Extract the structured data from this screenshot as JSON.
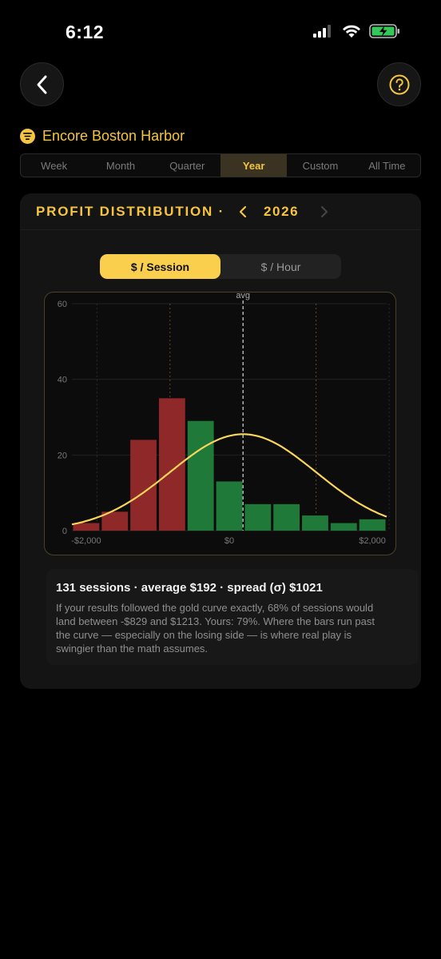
{
  "status_bar": {
    "time": "6:12",
    "icons": [
      "cellular-signal-icon",
      "wifi-icon",
      "battery-charging-icon"
    ],
    "battery_color": "#34c759"
  },
  "header": {
    "back_icon": "chevron-left-icon",
    "help_icon": "question-mark-icon",
    "accent_color": "#f5c542"
  },
  "venue": {
    "icon": "list-filter-icon",
    "name": "Encore Boston Harbor"
  },
  "range_tabs": {
    "items": [
      "Week",
      "Month",
      "Quarter",
      "Year",
      "Custom",
      "All Time"
    ],
    "selected": "Year"
  },
  "card": {
    "title": "PROFIT DISTRIBUTION ·",
    "year": "2026",
    "toggle": {
      "options": [
        "$ / Session",
        "$ / Hour"
      ],
      "selected": "$ / Session"
    }
  },
  "chart_data": {
    "type": "bar",
    "x_ticks": [
      "-$2,000",
      "$0",
      "$2,000"
    ],
    "y_ticks": [
      "0",
      "20",
      "40",
      "60"
    ],
    "ylim": [
      0,
      60
    ],
    "bars": [
      {
        "x0": -2200,
        "x1": -1800,
        "count": 2,
        "color": "#8f2828"
      },
      {
        "x0": -1800,
        "x1": -1400,
        "count": 5,
        "color": "#8f2828"
      },
      {
        "x0": -1400,
        "x1": -1000,
        "count": 24,
        "color": "#8f2828"
      },
      {
        "x0": -1000,
        "x1": -600,
        "count": 35,
        "color": "#8f2828"
      },
      {
        "x0": -600,
        "x1": -200,
        "count": 29,
        "color": "#1f7a3a"
      },
      {
        "x0": -200,
        "x1": 200,
        "count": 13,
        "color": "#1f7a3a"
      },
      {
        "x0": 200,
        "x1": 600,
        "count": 7,
        "color": "#1f7a3a"
      },
      {
        "x0": 600,
        "x1": 1000,
        "count": 7,
        "color": "#1f7a3a"
      },
      {
        "x0": 1000,
        "x1": 1400,
        "count": 4,
        "color": "#1f7a3a"
      },
      {
        "x0": 1400,
        "x1": 1800,
        "count": 2,
        "color": "#1f7a3a"
      },
      {
        "x0": 1800,
        "x1": 2200,
        "count": 3,
        "color": "#1f7a3a"
      }
    ],
    "curve": {
      "mean": 192,
      "sigma": 1021,
      "peak": 25.5,
      "color": "#f9d65a"
    },
    "avg_label": "avg",
    "gridlines": true
  },
  "summary": {
    "headline": "131 sessions · average $192 · spread (σ) $1021",
    "body": "If your results followed the gold curve exactly, 68% of sessions would land between -$829 and $1213. Yours: 79%. Where the bars run past the curve — especially on the losing side — is where real play is swingier than the math assumes."
  }
}
